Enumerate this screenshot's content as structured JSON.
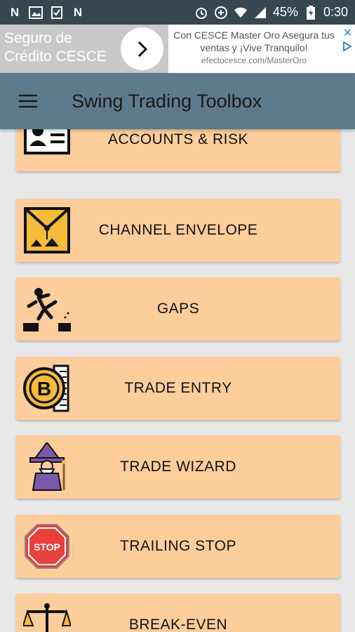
{
  "status_bar": {
    "battery": "45%",
    "time": "0:30"
  },
  "ad": {
    "headline": "Seguro de Crédito CESCE",
    "body": "Con CESCE Master Oro Asegura tus ventas y ¡Vive Tranquilo!",
    "url": "efectocesce.com/MasterOro",
    "close": "✕"
  },
  "app": {
    "title": "Swing Trading Toolbox"
  },
  "menu": {
    "items": [
      {
        "label": "ACCOUNTS & RISK",
        "icon": "id-card-icon"
      },
      {
        "label": "CHANNEL ENVELOPE",
        "icon": "envelope-icon"
      },
      {
        "label": "GAPS",
        "icon": "jumping-person-icon"
      },
      {
        "label": "TRADE ENTRY",
        "icon": "bitcoin-coin-icon"
      },
      {
        "label": "TRADE WIZARD",
        "icon": "wizard-icon"
      },
      {
        "label": "TRAILING STOP",
        "icon": "stop-sign-icon"
      },
      {
        "label": "BREAK-EVEN",
        "icon": "balance-scale-icon"
      }
    ]
  },
  "colors": {
    "status_bar": "#36474f",
    "app_bar": "#5e7b8d",
    "card": "#fdcd9b",
    "background": "#e8e8e8"
  }
}
